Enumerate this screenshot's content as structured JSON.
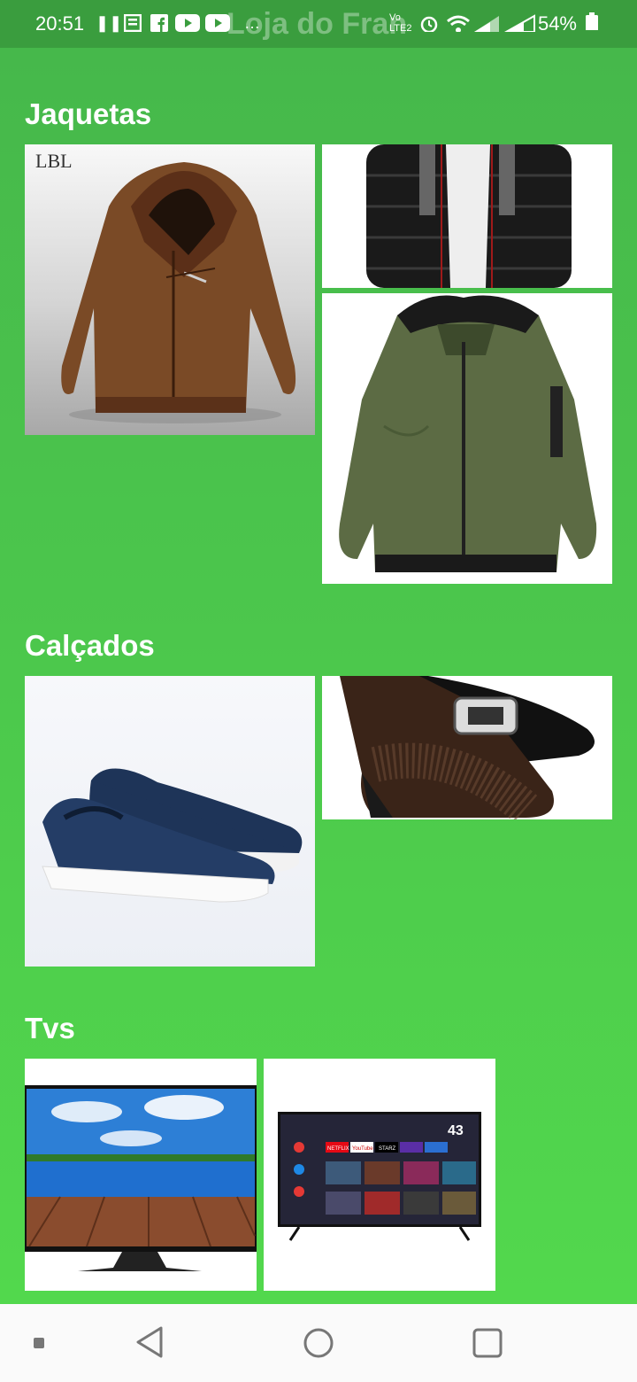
{
  "status_bar": {
    "time": "20:51",
    "battery": "54%",
    "title_ghost": "Loja do Fran",
    "network": "Vo LTE2"
  },
  "sections": [
    {
      "title": "Jaquetas",
      "products": [
        "jaqueta-couro-marrom",
        "jaqueta-puffer-preta",
        "jaqueta-bomber-verde"
      ]
    },
    {
      "title": "Calçados",
      "products": [
        "tenis-slip-on-azul",
        "sapato-social-marrom"
      ]
    },
    {
      "title": "Tvs",
      "products": [
        "tv-paisagem",
        "smart-tv-android"
      ]
    }
  ],
  "jacket_brand": "LBL",
  "tv_time": "43",
  "tv_apps": [
    "NETFLIX",
    "YouTube",
    "STARZ"
  ],
  "colors": {
    "status_bar": "#3a9d3e",
    "background": "#4fd24f"
  }
}
